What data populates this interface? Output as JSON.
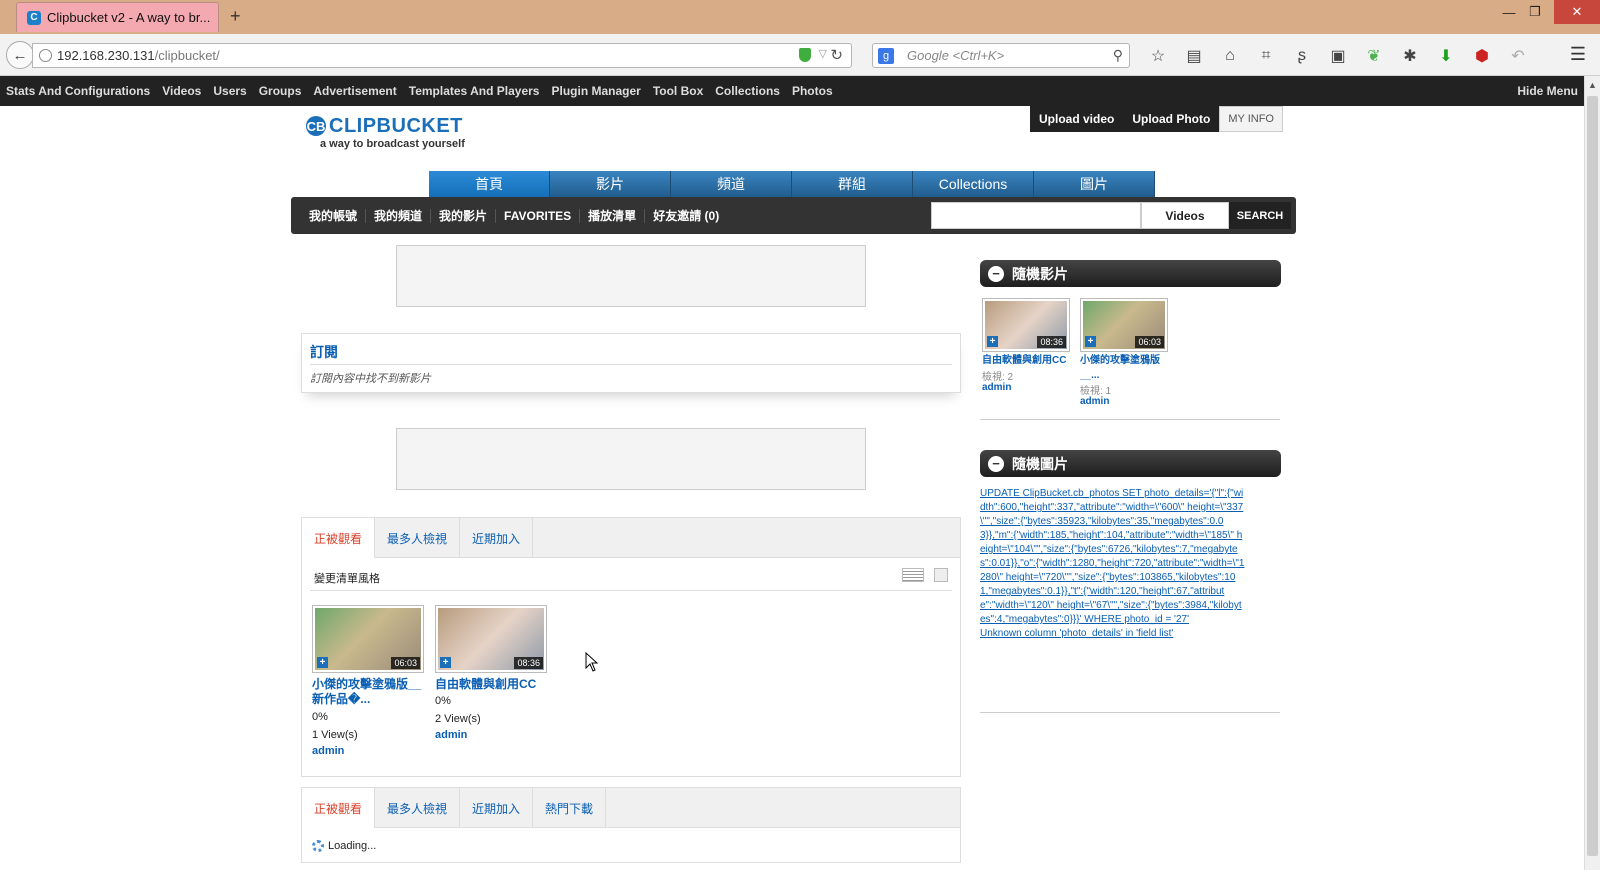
{
  "browser": {
    "tab_title": "Clipbucket v2 - A way to br...",
    "url_host": "192.168.230.131",
    "url_path": "/clipbucket/",
    "search_placeholder": "Google <Ctrl+K>"
  },
  "admin_bar": {
    "items": [
      "Stats And Configurations",
      "Videos",
      "Users",
      "Groups",
      "Advertisement",
      "Templates And Players",
      "Plugin Manager",
      "Tool Box",
      "Collections",
      "Photos"
    ],
    "hide_menu": "Hide Menu"
  },
  "site": {
    "logo_text": "CLIPBUCKET",
    "logo_mark": "CB",
    "tagline": "a way to broadcast yourself",
    "upload_video": "Upload video",
    "upload_photo": "Upload Photo",
    "my_info": "MY INFO",
    "main_tabs": [
      "首頁",
      "影片",
      "頻道",
      "群組",
      "Collections",
      "圖片"
    ],
    "sub_nav": [
      "我的帳號",
      "我的頻道",
      "我的影片",
      "FAVORITES",
      "播放清單",
      "好友邀請 (0)"
    ],
    "search_type": "Videos",
    "search_button": "SEARCH"
  },
  "subscriptions": {
    "title": "訂閱",
    "empty": "訂閱內容中找不到新影片"
  },
  "videos_panel": {
    "tabs": [
      "正被觀看",
      "最多人檢視",
      "近期加入"
    ],
    "list_style_label": "變更清單風格",
    "items": [
      {
        "title": "小傑的攻擊塗鴉版__新作品�...",
        "duration": "06:03",
        "rating": "0%",
        "views": "1 View(s)",
        "user": "admin"
      },
      {
        "title": "自由軟體與創用CC",
        "duration": "08:36",
        "rating": "0%",
        "views": "2 View(s)",
        "user": "admin"
      }
    ]
  },
  "bottom_panel": {
    "tabs": [
      "正被觀看",
      "最多人檢視",
      "近期加入",
      "熱門下載"
    ],
    "loading": "Loading..."
  },
  "sidebar": {
    "random_videos_title": "隨機影片",
    "random_videos": [
      {
        "title": "自由軟體與創用CC",
        "views": "檢視: 2",
        "user": "admin",
        "duration": "08:36"
      },
      {
        "title": "小傑的攻擊塗鴉版__...",
        "views": "檢視: 1",
        "user": "admin",
        "duration": "06:03"
      }
    ],
    "random_photos_title": "隨機圖片",
    "sql_error": "UPDATE ClipBucket.cb_photos SET photo_details='{\"l\":{\"width\":600,\"height\":337,\"attribute\":\"width=\\\"600\\\" height=\\\"337\\\"\",\"size\":{\"bytes\":35923,\"kilobytes\":35,\"megabytes\":0.03}},\"m\":{\"width\":185,\"height\":104,\"attribute\":\"width=\\\"185\\\" height=\\\"104\\\"\",\"size\":{\"bytes\":6726,\"kilobytes\":7,\"megabytes\":0.01}},\"o\":{\"width\":1280,\"height\":720,\"attribute\":\"width=\\\"1280\\\" height=\\\"720\\\"\",\"size\":{\"bytes\":103865,\"kilobytes\":101,\"megabytes\":0.1}},\"t\":{\"width\":120,\"height\":67,\"attribute\":\"width=\\\"120\\\" height=\\\"67\\\"\",\"size\":{\"bytes\":3984,\"kilobytes\":4,\"megabytes\":0}}}' WHERE photo_id = '27'",
    "sql_error_2": "Unknown column 'photo_details' in 'field list'"
  }
}
